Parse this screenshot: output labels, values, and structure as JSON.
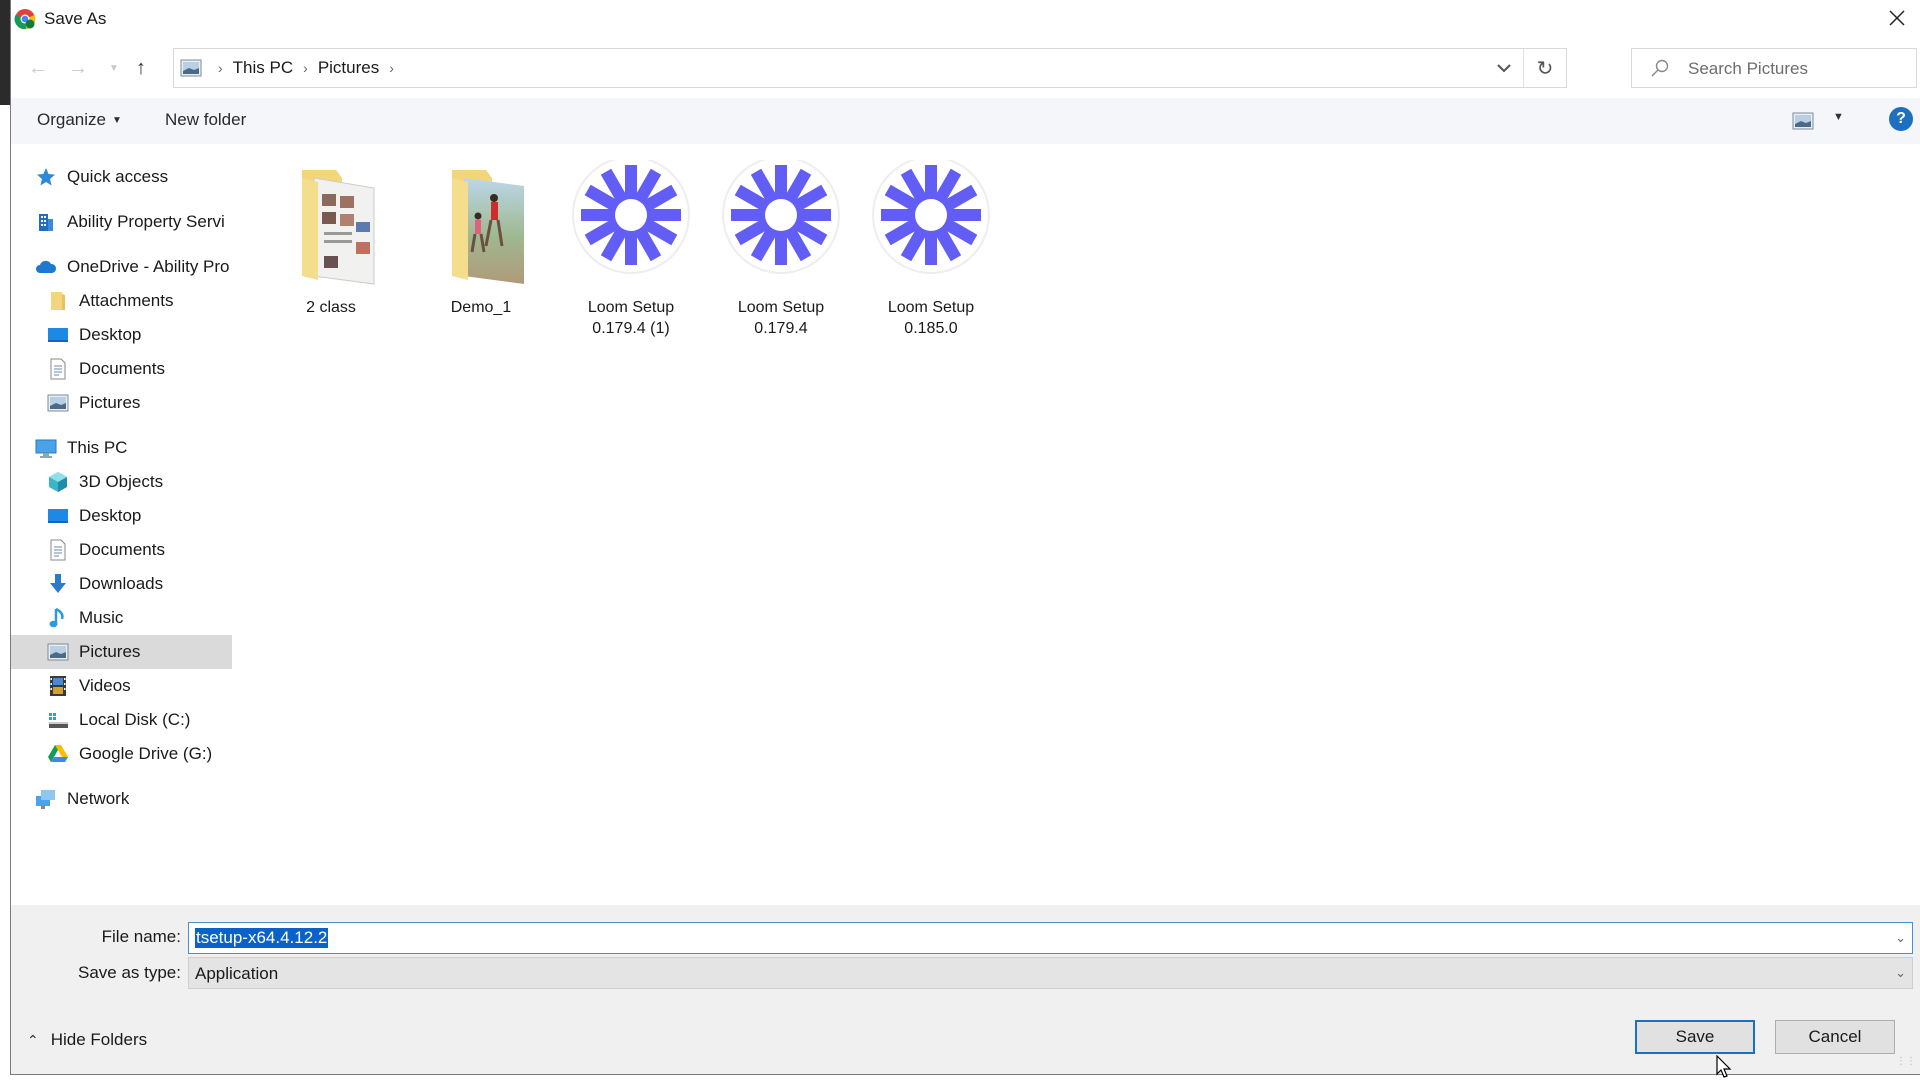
{
  "window": {
    "title": "Save As",
    "app_icon": "chrome-icon",
    "close_icon": "close-icon"
  },
  "nav": {
    "back_icon": "back-arrow-icon",
    "forward_icon": "forward-arrow-icon",
    "recent_icon": "chevron-down-icon",
    "up_icon": "up-arrow-icon",
    "breadcrumb": [
      "This PC",
      "Pictures"
    ],
    "refresh_icon": "refresh-icon",
    "search_placeholder": "Search Pictures"
  },
  "commandbar": {
    "organize_label": "Organize",
    "new_folder_label": "New folder",
    "view_icon": "change-view-icon",
    "help_label": "?"
  },
  "sidebar": {
    "items": [
      {
        "label": "Quick access",
        "icon": "star-icon",
        "level": 0
      },
      {
        "label": "Ability Property Servi",
        "icon": "building-icon",
        "level": 0
      },
      {
        "label": "OneDrive - Ability Pro",
        "icon": "cloud-icon",
        "level": 0
      },
      {
        "label": "Attachments",
        "icon": "folder-icon",
        "level": 1
      },
      {
        "label": "Desktop",
        "icon": "desktop-icon",
        "level": 1
      },
      {
        "label": "Documents",
        "icon": "documents-icon",
        "level": 1
      },
      {
        "label": "Pictures",
        "icon": "pictures-icon",
        "level": 1
      },
      {
        "label": "This PC",
        "icon": "computer-icon",
        "level": 0
      },
      {
        "label": "3D Objects",
        "icon": "3d-objects-icon",
        "level": 1
      },
      {
        "label": "Desktop",
        "icon": "desktop-icon",
        "level": 1
      },
      {
        "label": "Documents",
        "icon": "documents-icon",
        "level": 1
      },
      {
        "label": "Downloads",
        "icon": "downloads-icon",
        "level": 1
      },
      {
        "label": "Music",
        "icon": "music-icon",
        "level": 1
      },
      {
        "label": "Pictures",
        "icon": "pictures-icon",
        "level": 1,
        "selected": true
      },
      {
        "label": "Videos",
        "icon": "videos-icon",
        "level": 1
      },
      {
        "label": "Local Disk (C:)",
        "icon": "local-disk-icon",
        "level": 1
      },
      {
        "label": "Google Drive (G:)",
        "icon": "google-drive-icon",
        "level": 1
      },
      {
        "label": "Network",
        "icon": "network-icon",
        "level": 0
      }
    ]
  },
  "files": [
    {
      "name": "2 class",
      "type": "folder",
      "icon": "folder-with-documents-icon"
    },
    {
      "name": "Demo_1",
      "type": "folder",
      "icon": "folder-with-photos-icon"
    },
    {
      "name": "Loom Setup 0.179.4 (1)",
      "line1": "Loom Setup",
      "line2": "0.179.4 (1)",
      "type": "application",
      "icon": "loom-icon"
    },
    {
      "name": "Loom Setup 0.179.4",
      "line1": "Loom Setup",
      "line2": "0.179.4",
      "type": "application",
      "icon": "loom-icon"
    },
    {
      "name": "Loom Setup 0.185.0",
      "line1": "Loom Setup",
      "line2": "0.185.0",
      "type": "application",
      "icon": "loom-icon"
    }
  ],
  "footer": {
    "file_name_label": "File name:",
    "file_name_value": "tsetup-x64.4.12.2",
    "save_as_type_label": "Save as type:",
    "save_as_type_value": "Application",
    "hide_folders_label": "Hide Folders",
    "save_label": "Save",
    "cancel_label": "Cancel"
  },
  "colors": {
    "accent": "#1e6fc0",
    "selection": "#0a62c9",
    "loom": "#625df5",
    "sidebar_selected": "#dadada"
  }
}
